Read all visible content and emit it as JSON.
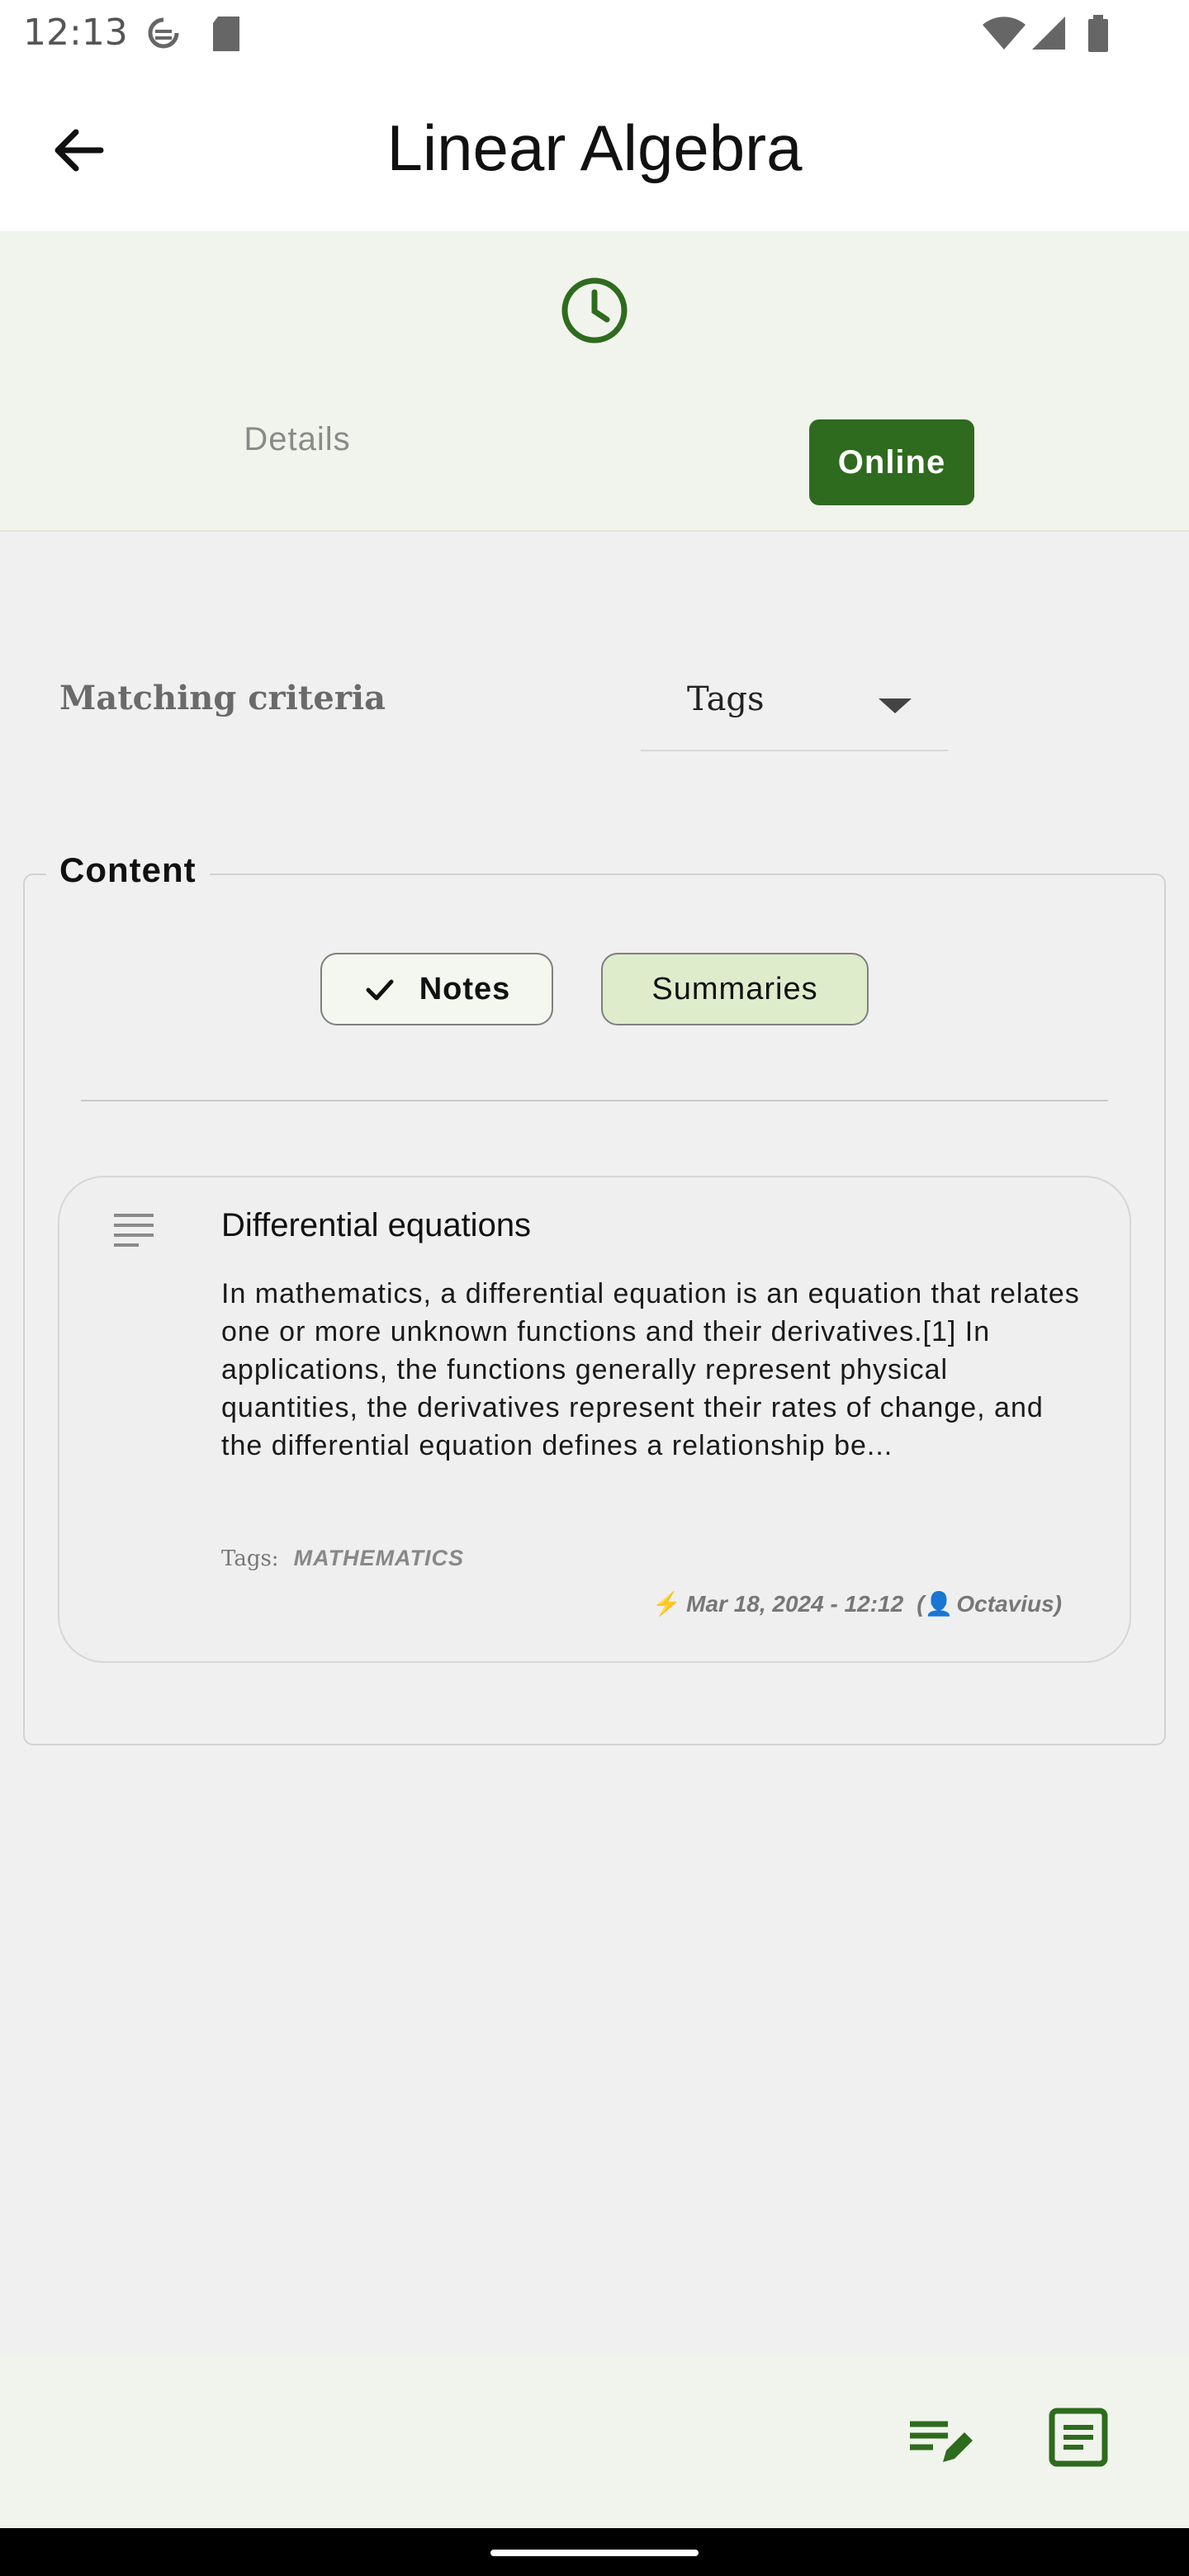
{
  "status_bar": {
    "time": "12:13"
  },
  "app_bar": {
    "title": "Linear Algebra"
  },
  "tabs": [
    {
      "label": "Details",
      "selected": false
    },
    {
      "label": "Online",
      "selected": true
    }
  ],
  "matching_criteria": {
    "label": "Matching criteria",
    "value": "Tags"
  },
  "content": {
    "legend": "Content",
    "filters": [
      {
        "label": "Notes",
        "selected": true
      },
      {
        "label": "Summaries",
        "selected": false
      }
    ],
    "items": [
      {
        "title": "Differential equations",
        "body": "In mathematics, a differential equation is an equation that relates one or more unknown functions and their derivatives.[1] In applications, the functions generally represent physical quantities, the derivatives represent their rates of change, and the differential equation defines a relationship be...",
        "tags_label": "Tags:",
        "tag": "MATHEMATICS",
        "date": "Mar 18, 2024 - 12:12",
        "author": "Octavius"
      }
    ]
  },
  "colors": {
    "accent": "#2e6b1e",
    "header_bg": "#f1f4ec",
    "chip_selected_bg": "#dfeccc"
  },
  "icons": [
    "back-arrow-icon",
    "clock-icon",
    "check-icon",
    "notes-lines-icon",
    "bolt-icon",
    "user-icon",
    "edit-note-icon",
    "article-icon"
  ]
}
